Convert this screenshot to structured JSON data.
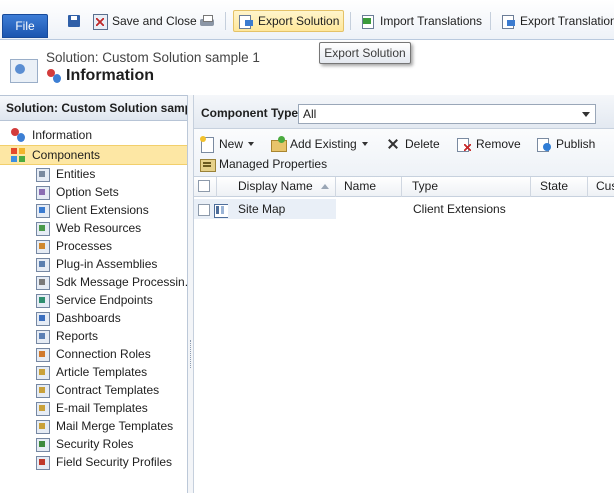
{
  "ribbon": {
    "file": "File",
    "save_and_close": "Save and Close",
    "export_solution": "Export Solution",
    "import_translations": "Import Translations",
    "export_translations": "Export Translations"
  },
  "tooltip": "Export Solution",
  "header": {
    "solution_title": "Solution: Custom Solution sample 1",
    "page_title": "Information"
  },
  "sidebar": {
    "heading": "Solution: Custom Solution samp...",
    "top_items": [
      {
        "label": "Information",
        "icon": "information-icon"
      },
      {
        "label": "Components",
        "icon": "components-icon"
      }
    ],
    "sub_items": [
      {
        "label": "Entities",
        "icon": "entities-icon",
        "color": "#7a8aa0"
      },
      {
        "label": "Option Sets",
        "icon": "option-sets-icon",
        "color": "#8a6db3"
      },
      {
        "label": "Client Extensions",
        "icon": "client-extensions-icon",
        "color": "#3b7bd0"
      },
      {
        "label": "Web Resources",
        "icon": "web-resources-icon",
        "color": "#4a9a4a"
      },
      {
        "label": "Processes",
        "icon": "processes-icon",
        "color": "#d0882e"
      },
      {
        "label": "Plug-in Assemblies",
        "icon": "plug-in-assemblies-icon",
        "color": "#5b7fb0"
      },
      {
        "label": "Sdk Message Processin...",
        "icon": "sdk-message-icon",
        "color": "#7a7a7a"
      },
      {
        "label": "Service Endpoints",
        "icon": "service-endpoints-icon",
        "color": "#2f8f6f"
      },
      {
        "label": "Dashboards",
        "icon": "dashboards-icon",
        "color": "#3b6fbf"
      },
      {
        "label": "Reports",
        "icon": "reports-icon",
        "color": "#5a7fb5"
      },
      {
        "label": "Connection Roles",
        "icon": "connection-roles-icon",
        "color": "#d07a2e"
      },
      {
        "label": "Article Templates",
        "icon": "article-templates-icon",
        "color": "#c9a13a"
      },
      {
        "label": "Contract Templates",
        "icon": "contract-templates-icon",
        "color": "#c9a13a"
      },
      {
        "label": "E-mail Templates",
        "icon": "email-templates-icon",
        "color": "#c9a13a"
      },
      {
        "label": "Mail Merge Templates",
        "icon": "mail-merge-templates-icon",
        "color": "#c9a13a"
      },
      {
        "label": "Security Roles",
        "icon": "security-roles-icon",
        "color": "#3d8a3d"
      },
      {
        "label": "Field Security Profiles",
        "icon": "field-security-profiles-icon",
        "color": "#c0392b"
      }
    ]
  },
  "main": {
    "component_type_label": "Component Type",
    "component_type_value": "All",
    "toolbar": {
      "new": "New",
      "add_existing": "Add Existing",
      "delete": "Delete",
      "remove": "Remove",
      "publish": "Publish",
      "managed_properties": "Managed Properties"
    },
    "grid": {
      "columns": [
        "Display Name",
        "Name",
        "Type",
        "State",
        "Cus"
      ],
      "rows": [
        {
          "display_name": "Site Map",
          "name": "",
          "type": "Client Extensions",
          "state": ""
        }
      ]
    }
  },
  "colors": {
    "selected_nav": "#fde7a4",
    "file_button": "#1b55b0"
  }
}
